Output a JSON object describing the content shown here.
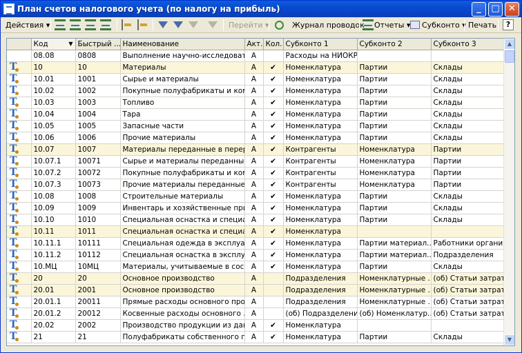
{
  "window": {
    "title": "План счетов налогового учета (по налогу на прибыль)",
    "controls": {
      "minimize": "_",
      "maximize": "□",
      "close": "✕"
    }
  },
  "toolbar": {
    "actions": "Действия ▾",
    "goto": "Перейти ▾",
    "journal": "Журнал проводок",
    "reports": "Отчеты ▾",
    "subconto": "Субконто ▾",
    "print": "Печать",
    "help": "?"
  },
  "columns": [
    "",
    "Код",
    "Быстрый ...",
    "Наименование",
    "Акт.",
    "Кол.",
    "Субконто 1",
    "Субконто 2",
    "Субконто 3"
  ],
  "rows": [
    {
      "group": false,
      "icon": false,
      "code": "08.08",
      "fast": "0808",
      "name": "Выполнение научно-исследоват...",
      "act": "А",
      "qty": "",
      "s1": "Расходы на НИОКР",
      "s2": "",
      "s3": ""
    },
    {
      "group": true,
      "icon": true,
      "code": "10",
      "fast": "10",
      "name": "Материалы",
      "act": "А",
      "qty": "✔",
      "s1": "Номенклатура",
      "s2": "Партии",
      "s3": "Склады"
    },
    {
      "group": false,
      "icon": true,
      "code": "10.01",
      "fast": "1001",
      "name": "Сырье и материалы",
      "act": "А",
      "qty": "✔",
      "s1": "Номенклатура",
      "s2": "Партии",
      "s3": "Склады"
    },
    {
      "group": false,
      "icon": true,
      "code": "10.02",
      "fast": "1002",
      "name": "Покупные полуфабрикаты и ком...",
      "act": "А",
      "qty": "✔",
      "s1": "Номенклатура",
      "s2": "Партии",
      "s3": "Склады"
    },
    {
      "group": false,
      "icon": true,
      "code": "10.03",
      "fast": "1003",
      "name": "Топливо",
      "act": "А",
      "qty": "✔",
      "s1": "Номенклатура",
      "s2": "Партии",
      "s3": "Склады"
    },
    {
      "group": false,
      "icon": true,
      "code": "10.04",
      "fast": "1004",
      "name": "Тара",
      "act": "А",
      "qty": "✔",
      "s1": "Номенклатура",
      "s2": "Партии",
      "s3": "Склады"
    },
    {
      "group": false,
      "icon": true,
      "code": "10.05",
      "fast": "1005",
      "name": "Запасные части",
      "act": "А",
      "qty": "✔",
      "s1": "Номенклатура",
      "s2": "Партии",
      "s3": "Склады"
    },
    {
      "group": false,
      "icon": true,
      "code": "10.06",
      "fast": "1006",
      "name": "Прочие материалы",
      "act": "А",
      "qty": "✔",
      "s1": "Номенклатура",
      "s2": "Партии",
      "s3": "Склады"
    },
    {
      "group": true,
      "icon": true,
      "code": "10.07",
      "fast": "1007",
      "name": "Материалы переданные в перер...",
      "act": "А",
      "qty": "✔",
      "s1": "Контрагенты",
      "s2": "Номенклатура",
      "s3": "Партии"
    },
    {
      "group": false,
      "icon": true,
      "code": "10.07.1",
      "fast": "10071",
      "name": "Сырье и материалы переданные...",
      "act": "А",
      "qty": "✔",
      "s1": "Контрагенты",
      "s2": "Номенклатура",
      "s3": "Партии"
    },
    {
      "group": false,
      "icon": true,
      "code": "10.07.2",
      "fast": "10072",
      "name": "Покупные полуфабрикаты и ком...",
      "act": "А",
      "qty": "✔",
      "s1": "Контрагенты",
      "s2": "Номенклатура",
      "s3": "Партии"
    },
    {
      "group": false,
      "icon": true,
      "code": "10.07.3",
      "fast": "10073",
      "name": "Прочие материалы переданные ...",
      "act": "А",
      "qty": "✔",
      "s1": "Контрагенты",
      "s2": "Номенклатура",
      "s3": "Партии"
    },
    {
      "group": false,
      "icon": true,
      "code": "10.08",
      "fast": "1008",
      "name": "Строительные материалы",
      "act": "А",
      "qty": "✔",
      "s1": "Номенклатура",
      "s2": "Партии",
      "s3": "Склады"
    },
    {
      "group": false,
      "icon": true,
      "code": "10.09",
      "fast": "1009",
      "name": "Инвентарь и хозяйственные при...",
      "act": "А",
      "qty": "✔",
      "s1": "Номенклатура",
      "s2": "Партии",
      "s3": "Склады"
    },
    {
      "group": false,
      "icon": true,
      "code": "10.10",
      "fast": "1010",
      "name": "Специальная оснастка и специа...",
      "act": "А",
      "qty": "✔",
      "s1": "Номенклатура",
      "s2": "Партии",
      "s3": "Склады"
    },
    {
      "group": true,
      "icon": true,
      "code": "10.11",
      "fast": "1011",
      "name": "Специальная оснастка и специа...",
      "act": "А",
      "qty": "✔",
      "s1": "Номенклатура",
      "s2": "",
      "s3": ""
    },
    {
      "group": false,
      "icon": true,
      "code": "10.11.1",
      "fast": "10111",
      "name": "Специальная одежда в эксплуат...",
      "act": "А",
      "qty": "✔",
      "s1": "Номенклатура",
      "s2": "Партии материал...",
      "s3": "Работники органи..."
    },
    {
      "group": false,
      "icon": true,
      "code": "10.11.2",
      "fast": "10112",
      "name": "Специальная оснастка в эксплу...",
      "act": "А",
      "qty": "✔",
      "s1": "Номенклатура",
      "s2": "Партии материал...",
      "s3": "Подразделения"
    },
    {
      "group": false,
      "icon": true,
      "code": "10.МЦ",
      "fast": "10МЦ",
      "name": "Материалы, учитываемые в сос...",
      "act": "А",
      "qty": "✔",
      "s1": "Номенклатура",
      "s2": "Партии",
      "s3": "Склады"
    },
    {
      "group": true,
      "icon": true,
      "code": "20",
      "fast": "20",
      "name": "Основное производство",
      "act": "А",
      "qty": "",
      "s1": "Подразделения",
      "s2": "Номенклатурные ...",
      "s3": "(об) Статьи затрат"
    },
    {
      "group": true,
      "icon": true,
      "code": "20.01",
      "fast": "2001",
      "name": "Основное производство",
      "act": "А",
      "qty": "",
      "s1": "Подразделения",
      "s2": "Номенклатурные ...",
      "s3": "(об) Статьи затрат"
    },
    {
      "group": false,
      "icon": true,
      "code": "20.01.1",
      "fast": "20011",
      "name": "Прямые расходы основного про...",
      "act": "А",
      "qty": "",
      "s1": "Подразделения",
      "s2": "Номенклатурные ...",
      "s3": "(об) Статьи затрат"
    },
    {
      "group": false,
      "icon": true,
      "code": "20.01.2",
      "fast": "20012",
      "name": "Косвенные расходы основного ...",
      "act": "А",
      "qty": "",
      "s1": "(об) Подразделения",
      "s2": "(об) Номенклатур...",
      "s3": "(об) Статьи затрат"
    },
    {
      "group": false,
      "icon": true,
      "code": "20.02",
      "fast": "2002",
      "name": "Производство продукции из дав...",
      "act": "А",
      "qty": "✔",
      "s1": "Номенклатура",
      "s2": "",
      "s3": ""
    },
    {
      "group": false,
      "icon": true,
      "code": "21",
      "fast": "21",
      "name": "Полуфабрикаты собственного п...",
      "act": "А",
      "qty": "✔",
      "s1": "Номенклатура",
      "s2": "Партии",
      "s3": "Склады"
    }
  ],
  "colors": {
    "title_bar": "#0a4ad0",
    "group_row": "#fbf6d9",
    "header": "#ece9d8"
  },
  "scrollbar": {
    "up": "▲",
    "down": "▼"
  }
}
